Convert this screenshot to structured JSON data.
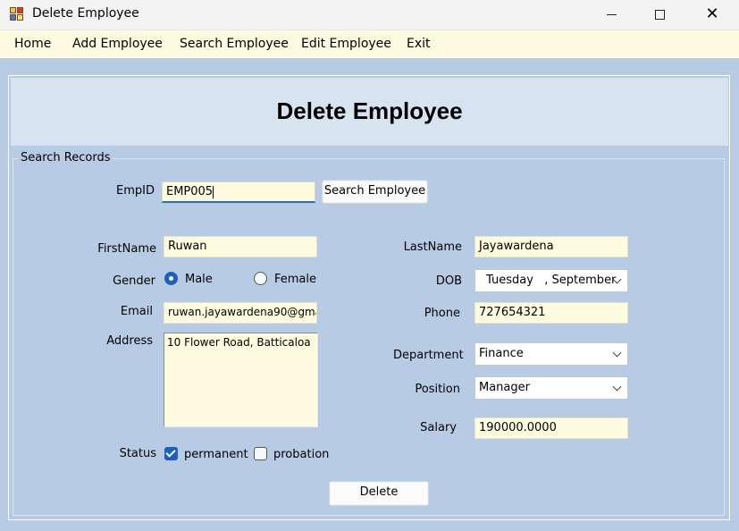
{
  "window": {
    "title": "Delete Employee",
    "controls": {
      "minimize": "minimize-icon",
      "maximize": "maximize-icon",
      "close": "close-icon"
    }
  },
  "menu": {
    "items": [
      "Home",
      "Add Employee",
      "Search Employee",
      "Edit Employee",
      "Exit"
    ]
  },
  "header": {
    "title": "Delete Employee"
  },
  "search": {
    "group_label": "Search Records",
    "empid_label": "EmpID",
    "empid_value": "EMP005",
    "button_label": "Search Employee"
  },
  "form": {
    "first_name_label": "FirstName",
    "first_name_value": "Ruwan",
    "last_name_label": "LastName",
    "last_name_value": "Jayawardena",
    "gender_label": "Gender",
    "gender_options": [
      "Male",
      "Female"
    ],
    "gender_selected": "Male",
    "dob_label": "DOB",
    "dob_value": "Tuesday   , September",
    "email_label": "Email",
    "email_value": "ruwan.jayawardena90@gma",
    "phone_label": "Phone",
    "phone_value": "727654321",
    "address_label": "Address",
    "address_value": "10 Flower Road, Batticaloa",
    "department_label": "Department",
    "department_value": "Finance",
    "position_label": "Position",
    "position_value": "Manager",
    "salary_label": "Salary",
    "salary_value": "190000.0000",
    "status_label": "Status",
    "status_options": [
      "permanent",
      "probation"
    ],
    "status_permanent_checked": true,
    "status_probation_checked": false
  },
  "actions": {
    "delete_label": "Delete"
  },
  "colors": {
    "background": "#b7cce4",
    "header_panel": "#d7e3f1",
    "input_background": "#fdfbe0",
    "accent": "#1f5fb8"
  }
}
